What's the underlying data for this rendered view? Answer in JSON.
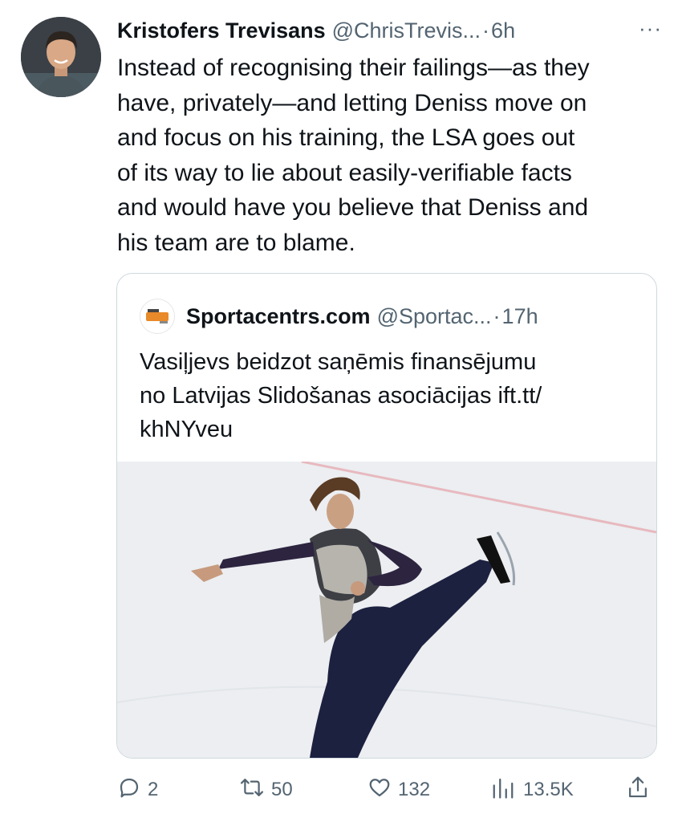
{
  "tweet": {
    "author_name": "Kristofers Trevisans",
    "author_handle": "@ChrisTrevis...",
    "separator": "·",
    "time": "6h",
    "more_label": "···",
    "text": "Instead of recognising their failings—as they\nhave, privately—and letting Deniss move on\nand focus on his training, the LSA goes out\nof its way to lie about easily-verifiable facts\nand would have you believe that Deniss and\nhis team are to blame."
  },
  "quoted": {
    "author_name": "Sportacentrs.com",
    "author_handle": "@Sportac...",
    "separator": "·",
    "time": "17h",
    "text": "Vasiļjevs beidzot saņēmis finansējumu\nno Latvijas Slidošanas asociācijas ift.tt/\nkhNYveu",
    "logo_icon": "sportacentrs-logo",
    "media_icon": "figure-skater-photo"
  },
  "actions": {
    "replies": "2",
    "reposts": "50",
    "likes": "132",
    "views": "13.5K"
  },
  "colors": {
    "text_primary": "#0f1419",
    "text_secondary": "#536471",
    "border": "#cfd9de"
  }
}
